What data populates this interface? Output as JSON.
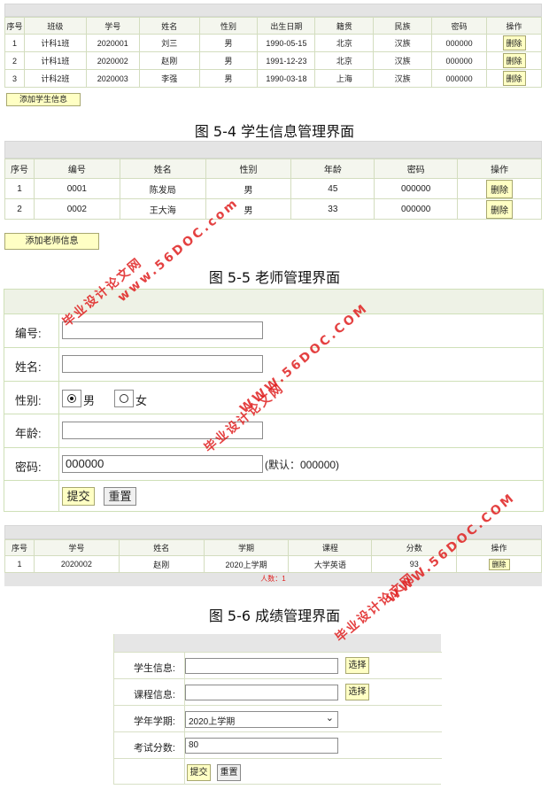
{
  "student_table": {
    "headers": [
      "序号",
      "班级",
      "学号",
      "姓名",
      "性别",
      "出生日期",
      "籍贯",
      "民族",
      "密码",
      "操作"
    ],
    "rows": [
      [
        "1",
        "计科1班",
        "2020001",
        "刘三",
        "男",
        "1990-05-15",
        "北京",
        "汉族",
        "000000",
        "删除"
      ],
      [
        "2",
        "计科1班",
        "2020002",
        "赵刚",
        "男",
        "1991-12-23",
        "北京",
        "汉族",
        "000000",
        "删除"
      ],
      [
        "3",
        "计科2班",
        "2020003",
        "李强",
        "男",
        "1990-03-18",
        "上海",
        "汉族",
        "000000",
        "删除"
      ]
    ],
    "add_button": "添加学生信息"
  },
  "caption_4": "图 5-4 学生信息管理界面",
  "teacher_table": {
    "headers": [
      "序号",
      "编号",
      "姓名",
      "性别",
      "年龄",
      "密码",
      "操作"
    ],
    "rows": [
      [
        "1",
        "0001",
        "陈发局",
        "男",
        "45",
        "000000",
        "删除"
      ],
      [
        "2",
        "0002",
        "王大海",
        "男",
        "33",
        "000000",
        "删除"
      ]
    ],
    "add_button": "添加老师信息"
  },
  "caption_5": "图 5-5 老师管理界面",
  "teacher_form": {
    "id_label": "编号:",
    "name_label": "姓名:",
    "gender_label": "性别:",
    "gender_male": "男",
    "gender_female": "女",
    "age_label": "年龄:",
    "password_label": "密码:",
    "password_value": "000000",
    "password_hint": "(默认：000000)",
    "submit": "提交",
    "reset": "重置"
  },
  "grade_table": {
    "headers": [
      "序号",
      "学号",
      "姓名",
      "学期",
      "课程",
      "分数",
      "操作"
    ],
    "rows": [
      [
        "1",
        "2020002",
        "赵刚",
        "2020上学期",
        "大学英语",
        "93",
        "删除"
      ]
    ],
    "count_text": "人数：1"
  },
  "caption_6": "图 5-6 成绩管理界面",
  "grade_form": {
    "student_label": "学生信息:",
    "course_label": "课程信息:",
    "term_label": "学年学期:",
    "term_value": "2020上学期",
    "score_label": "考试分数:",
    "score_value": "80",
    "select_button": "选择",
    "submit": "提交",
    "reset": "重置"
  },
  "watermark": {
    "site_name": "毕业设计论文网",
    "url": "www.56DOC.com",
    "url_caps": "WWW.56DOC.COM"
  },
  "colors": {
    "accent_button": "#ffffc4",
    "table_border": "#d3ddbf",
    "watermark": "#e02020",
    "count_text": "#e02020"
  }
}
